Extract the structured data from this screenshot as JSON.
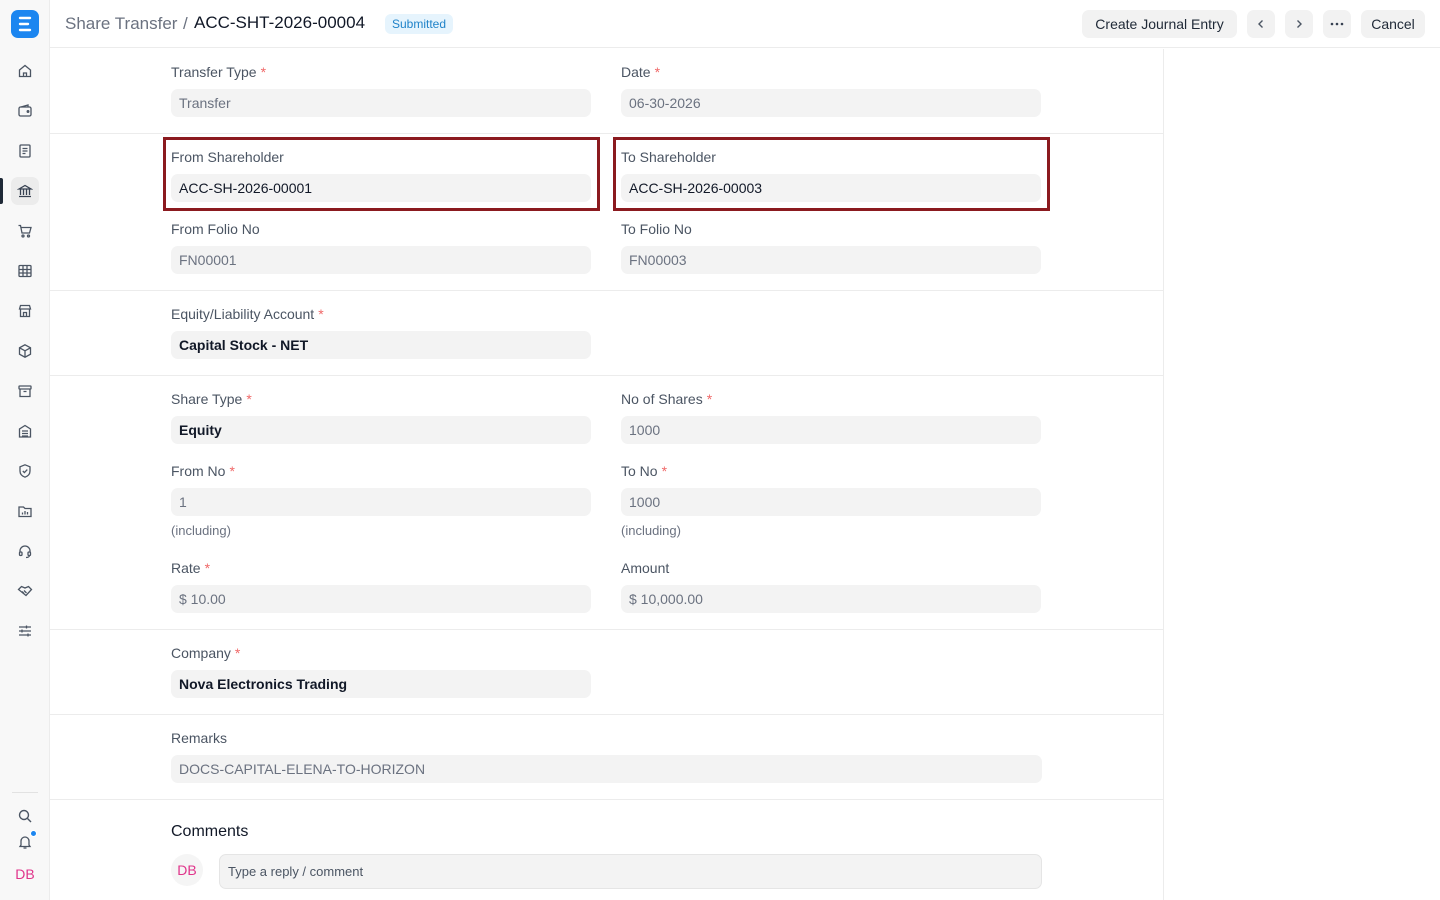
{
  "sidebar": {
    "logo": "E",
    "icons": [
      "home-icon",
      "wallet-icon",
      "invoice-icon",
      "bank-icon",
      "cart-icon",
      "table-icon",
      "store-icon",
      "box-icon",
      "archive-icon",
      "building-icon",
      "shield-icon",
      "folder-icon",
      "headset-icon",
      "handshake-icon",
      "sliders-icon"
    ],
    "bottom_icons": [
      "search-icon",
      "bell-icon"
    ],
    "avatar": "DB",
    "accent": "#1c86f0"
  },
  "header": {
    "breadcrumb": "Share Transfer",
    "separator": "/",
    "title": "ACC-SHT-2026-00004",
    "status": "Submitted",
    "create_journal_entry": "Create Journal Entry",
    "prev": "‹",
    "next": "›",
    "more": "···",
    "cancel": "Cancel"
  },
  "form": {
    "transfer_type": {
      "label": "Transfer Type",
      "value": "Transfer"
    },
    "date": {
      "label": "Date",
      "value": "06-30-2026"
    },
    "from_shareholder": {
      "label": "From Shareholder",
      "value": "ACC-SH-2026-00001"
    },
    "to_shareholder": {
      "label": "To Shareholder",
      "value": "ACC-SH-2026-00003"
    },
    "from_folio_no": {
      "label": "From Folio No",
      "value": "FN00001"
    },
    "to_folio_no": {
      "label": "To Folio No",
      "value": "FN00003"
    },
    "equity_account": {
      "label": "Equity/Liability Account",
      "value": "Capital Stock - NET"
    },
    "share_type": {
      "label": "Share Type",
      "value": "Equity"
    },
    "no_of_shares": {
      "label": "No of Shares",
      "value": "1000"
    },
    "from_no": {
      "label": "From No",
      "value": "1",
      "hint": "(including)"
    },
    "to_no": {
      "label": "To No",
      "value": "1000",
      "hint": "(including)"
    },
    "rate": {
      "label": "Rate",
      "value": "$ 10.00"
    },
    "amount": {
      "label": "Amount",
      "value": "$ 10,000.00"
    },
    "company": {
      "label": "Company",
      "value": "Nova Electronics Trading"
    },
    "remarks": {
      "label": "Remarks",
      "value": "DOCS-CAPITAL-ELENA-TO-HORIZON"
    },
    "required_mark": "*"
  },
  "comments": {
    "title": "Comments",
    "avatar": "DB",
    "placeholder": "Type a reply / comment"
  },
  "colors": {
    "highlight": "#8b1a1f",
    "required": "#f06868",
    "badge_bg": "#e6f4fd",
    "badge_text": "#2083c9"
  }
}
